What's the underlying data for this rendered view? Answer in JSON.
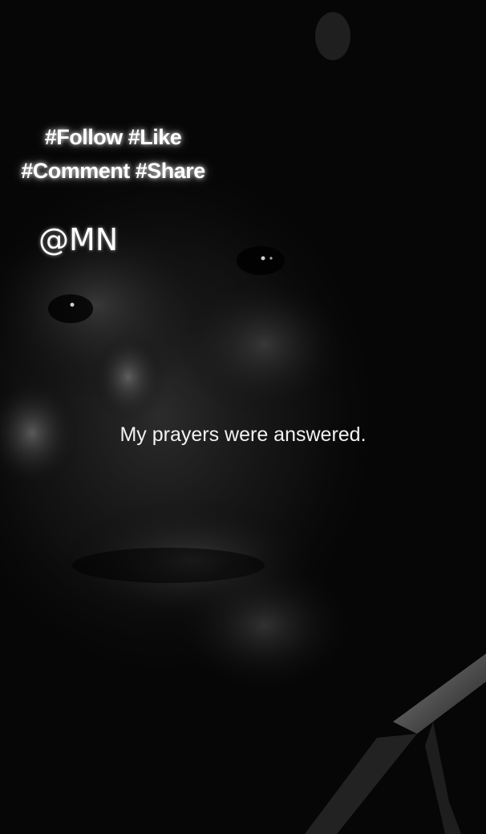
{
  "overlay": {
    "hashtags_line1": "#Follow #Like",
    "hashtags_line2": "#Comment #Share",
    "handle": "@MN"
  },
  "subtitle": "My prayers were answered.",
  "colors": {
    "background": "#050505",
    "text": "#ffffff"
  }
}
